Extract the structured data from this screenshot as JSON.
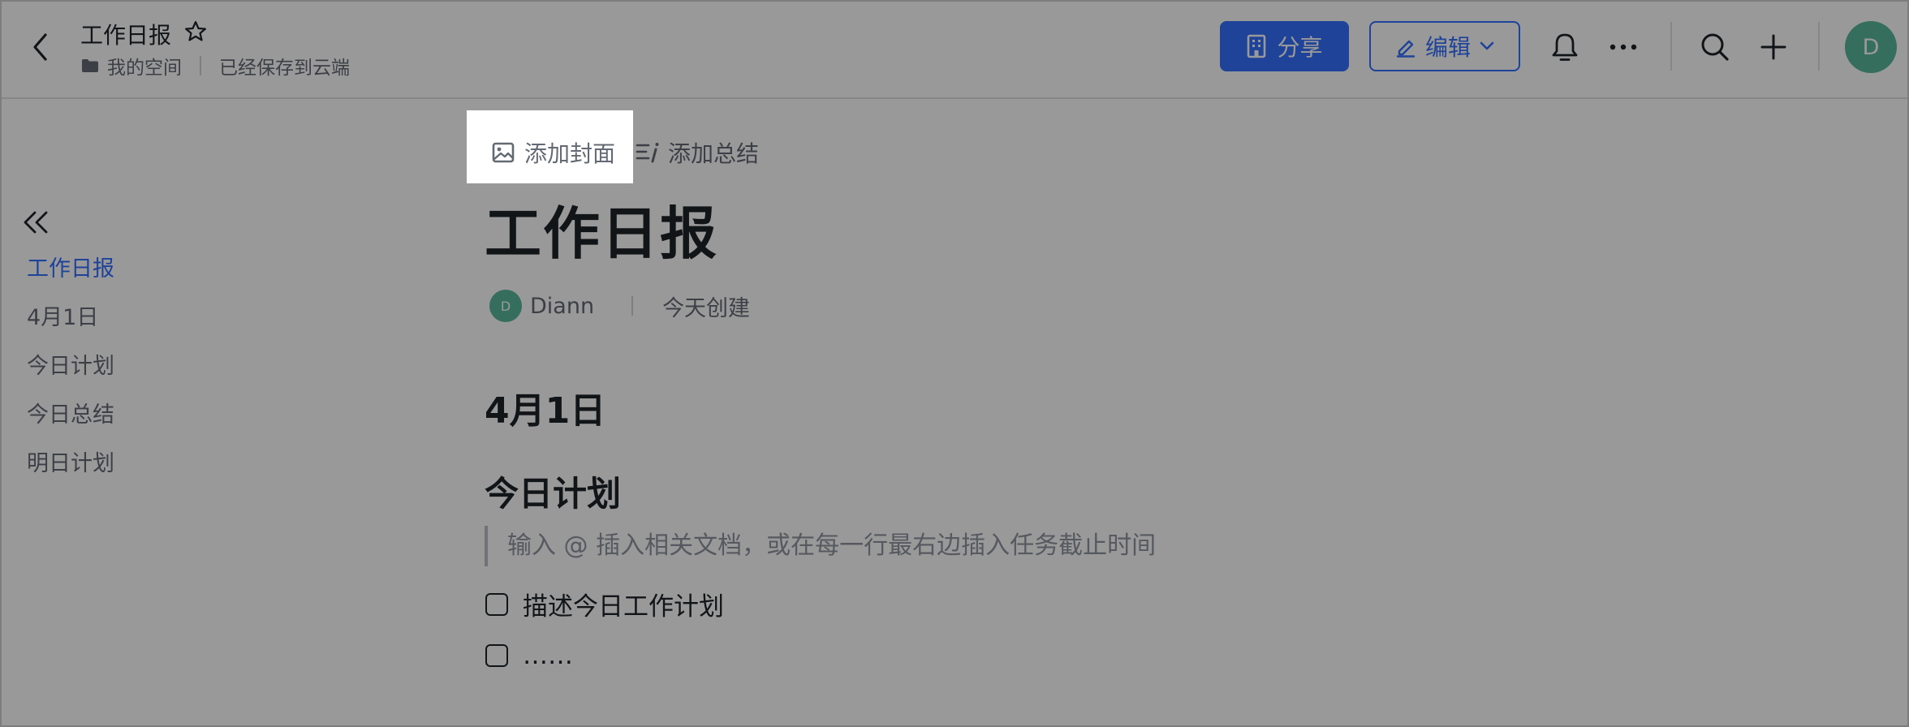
{
  "header": {
    "doc_title": "工作日报",
    "location": "我的空间",
    "save_status": "已经保存到云端",
    "share_label": "分享",
    "edit_label": "编辑",
    "avatar_initial": "D"
  },
  "sidebar": {
    "items": [
      {
        "label": "工作日报",
        "active": true
      },
      {
        "label": "4月1日",
        "active": false
      },
      {
        "label": "今日计划",
        "active": false
      },
      {
        "label": "今日总结",
        "active": false
      },
      {
        "label": "明日计划",
        "active": false
      }
    ]
  },
  "doc": {
    "add_cover": "添加封面",
    "add_summary": "添加总结",
    "title": "工作日报",
    "author_initial": "D",
    "author": "Diann",
    "created": "今天创建",
    "heading_date": "4月1日",
    "heading_plan": "今日计划",
    "quote": "输入 @ 插入相关文档，或在每一行最右边插入任务截止时间",
    "todos": [
      "描述今日工作计划",
      "……"
    ]
  },
  "colors": {
    "accent": "#3370ff",
    "avatar": "#5bb89d",
    "overlay": "rgba(0,0,0,0.40)"
  }
}
